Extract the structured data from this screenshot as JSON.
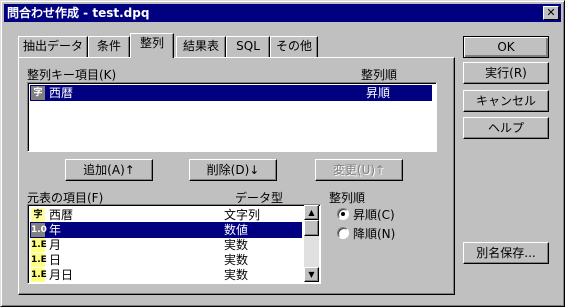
{
  "window": {
    "title": "問合わせ作成 - test.dpq",
    "close_glyph": "✕"
  },
  "tabs": [
    {
      "label": "抽出データ"
    },
    {
      "label": "条件"
    },
    {
      "label": "整列"
    },
    {
      "label": "結果表"
    },
    {
      "label": "SQL"
    },
    {
      "label": "その他"
    }
  ],
  "sort_keys": {
    "header_item": "整列キー項目(K)",
    "header_order": "整列順",
    "rows": [
      {
        "type_icon": "字",
        "name": "西暦",
        "order": "昇順",
        "selected": true
      }
    ]
  },
  "middle_buttons": {
    "add": "追加(A)↑",
    "delete": "削除(D)↓",
    "change": "変更(U)↑"
  },
  "source_items": {
    "header_item": "元表の項目(F)",
    "header_type": "データ型",
    "rows": [
      {
        "type_icon": "字",
        "name": "西暦",
        "type": "文字列",
        "selected": false
      },
      {
        "type_icon": "1.0",
        "name": "年",
        "type": "数値",
        "selected": true
      },
      {
        "type_icon": "1.E",
        "name": "月",
        "type": "実数",
        "selected": false
      },
      {
        "type_icon": "1.E",
        "name": "日",
        "type": "実数",
        "selected": false
      },
      {
        "type_icon": "1.E",
        "name": "月日",
        "type": "実数",
        "selected": false
      }
    ]
  },
  "sort_order": {
    "label": "整列順",
    "ascending": "昇順(C)",
    "descending": "降順(N)",
    "selected": "ascending"
  },
  "side_buttons": {
    "ok": "OK",
    "execute": "実行(R)",
    "cancel": "キャンセル",
    "help": "ヘルプ",
    "save_as": "別名保存..."
  }
}
